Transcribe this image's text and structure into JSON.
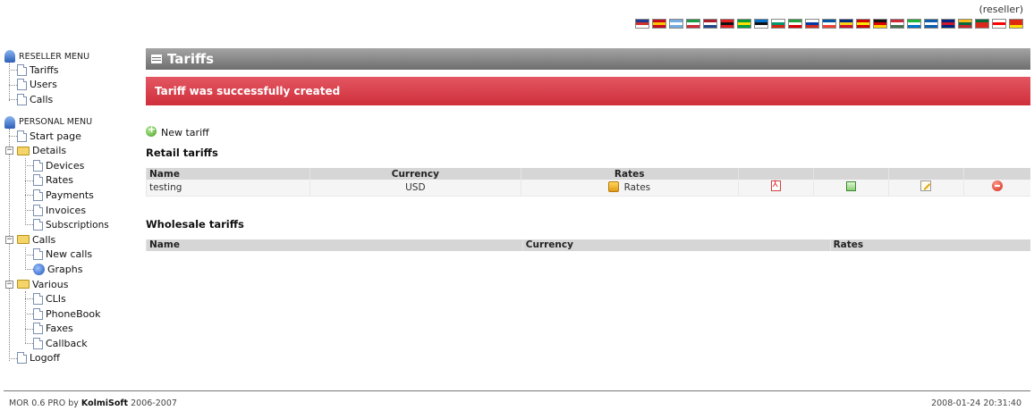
{
  "header": {
    "role": "(reseller)",
    "flags": [
      {
        "name": "flag-uk",
        "colors": [
          "#1f3a93",
          "#d0312d",
          "#ffffff"
        ]
      },
      {
        "name": "flag-es",
        "colors": [
          "#c60b1e",
          "#ffc400",
          "#c60b1e"
        ]
      },
      {
        "name": "flag-ar",
        "colors": [
          "#74acdf",
          "#ffffff",
          "#74acdf"
        ]
      },
      {
        "name": "flag-it",
        "colors": [
          "#1a9b46",
          "#ffffff",
          "#cf2b37"
        ]
      },
      {
        "name": "flag-nl",
        "colors": [
          "#ae1c28",
          "#ffffff",
          "#21468b"
        ]
      },
      {
        "name": "flag-al",
        "colors": [
          "#e41e20",
          "#111111",
          "#e41e20"
        ]
      },
      {
        "name": "flag-br",
        "colors": [
          "#009b3a",
          "#fedf00",
          "#009b3a"
        ]
      },
      {
        "name": "flag-ee",
        "colors": [
          "#0072ce",
          "#111111",
          "#ffffff"
        ]
      },
      {
        "name": "flag-bg",
        "colors": [
          "#ffffff",
          "#00966e",
          "#d62612"
        ]
      },
      {
        "name": "flag-ir",
        "colors": [
          "#239f40",
          "#ffffff",
          "#da0000"
        ]
      },
      {
        "name": "flag-ru",
        "colors": [
          "#ffffff",
          "#0039a6",
          "#d52b1e"
        ]
      },
      {
        "name": "flag-fr",
        "colors": [
          "#0055a4",
          "#ffffff",
          "#ef4135"
        ]
      },
      {
        "name": "flag-ro",
        "colors": [
          "#002b7f",
          "#fcd116",
          "#ce1126"
        ]
      },
      {
        "name": "flag-mk",
        "colors": [
          "#d20000",
          "#ffe600",
          "#d20000"
        ]
      },
      {
        "name": "flag-de",
        "colors": [
          "#111111",
          "#dd0000",
          "#ffce00"
        ]
      },
      {
        "name": "flag-hu",
        "colors": [
          "#ce2939",
          "#ffffff",
          "#477050"
        ]
      },
      {
        "name": "flag-sl",
        "colors": [
          "#1eb53a",
          "#ffffff",
          "#0072c6"
        ]
      },
      {
        "name": "flag-gr",
        "colors": [
          "#0d5eaf",
          "#ffffff",
          "#0d5eaf"
        ]
      },
      {
        "name": "flag-au",
        "colors": [
          "#00247d",
          "#cf142b",
          "#00247d"
        ]
      },
      {
        "name": "flag-lt",
        "colors": [
          "#fdb913",
          "#006a44",
          "#c1272d"
        ]
      },
      {
        "name": "flag-pt",
        "colors": [
          "#046a38",
          "#da291c",
          "#da291c"
        ]
      },
      {
        "name": "flag-ge",
        "colors": [
          "#ffffff",
          "#ff0000",
          "#ffffff"
        ]
      },
      {
        "name": "flag-cn",
        "colors": [
          "#de2910",
          "#de2910",
          "#ffde00"
        ]
      }
    ]
  },
  "sidebar": {
    "reseller_title": "RESELLER MENU",
    "reseller_items": [
      "Tariffs",
      "Users",
      "Calls"
    ],
    "personal_title": "PERSONAL MENU",
    "start_page": "Start page",
    "details": {
      "label": "Details",
      "items": [
        "Devices",
        "Rates",
        "Payments",
        "Invoices",
        "Subscriptions"
      ]
    },
    "calls": {
      "label": "Calls",
      "items": [
        "New calls",
        "Graphs"
      ]
    },
    "various": {
      "label": "Various",
      "items": [
        "CLIs",
        "PhoneBook",
        "Faxes",
        "Callback"
      ]
    },
    "logoff": "Logoff"
  },
  "main": {
    "title": "Tariffs",
    "notice": "Tariff was successfully created",
    "new_tariff": "New tariff",
    "retail": {
      "title": "Retail tariffs",
      "columns": [
        "Name",
        "Currency",
        "Rates"
      ],
      "rows": [
        {
          "name": "testing",
          "currency": "USD",
          "rates": "Rates"
        }
      ]
    },
    "wholesale": {
      "title": "Wholesale tariffs",
      "columns": [
        "Name",
        "Currency",
        "Rates"
      ]
    }
  },
  "footer": {
    "product": "MOR 0.6 PRO by ",
    "company": "KolmiSoft",
    "years": " 2006-2007",
    "datetime": "2008-01-24 20:31:40"
  }
}
